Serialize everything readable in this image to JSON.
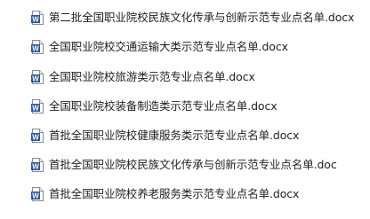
{
  "file_icon": "word-document-icon",
  "files": [
    {
      "name": "第二批全国职业院校民族文化传承与创新示范专业点名单.docx"
    },
    {
      "name": "全国职业院校交通运输大类示范专业点名单.docx"
    },
    {
      "name": "全国职业院校旅游类示范专业点名单.docx"
    },
    {
      "name": "全国职业院校装备制造类示范专业点名单.docx"
    },
    {
      "name": "首批全国职业院校健康服务类示范专业点名单.docx"
    },
    {
      "name": "首批全国职业院校民族文化传承与创新示范专业点名单.doc"
    },
    {
      "name": "首批全国职业院校养老服务类示范专业点名单.docx"
    }
  ],
  "colors": {
    "icon_blue": "#2b579a",
    "icon_light": "#e8eef8",
    "text": "#1f1f1f"
  }
}
